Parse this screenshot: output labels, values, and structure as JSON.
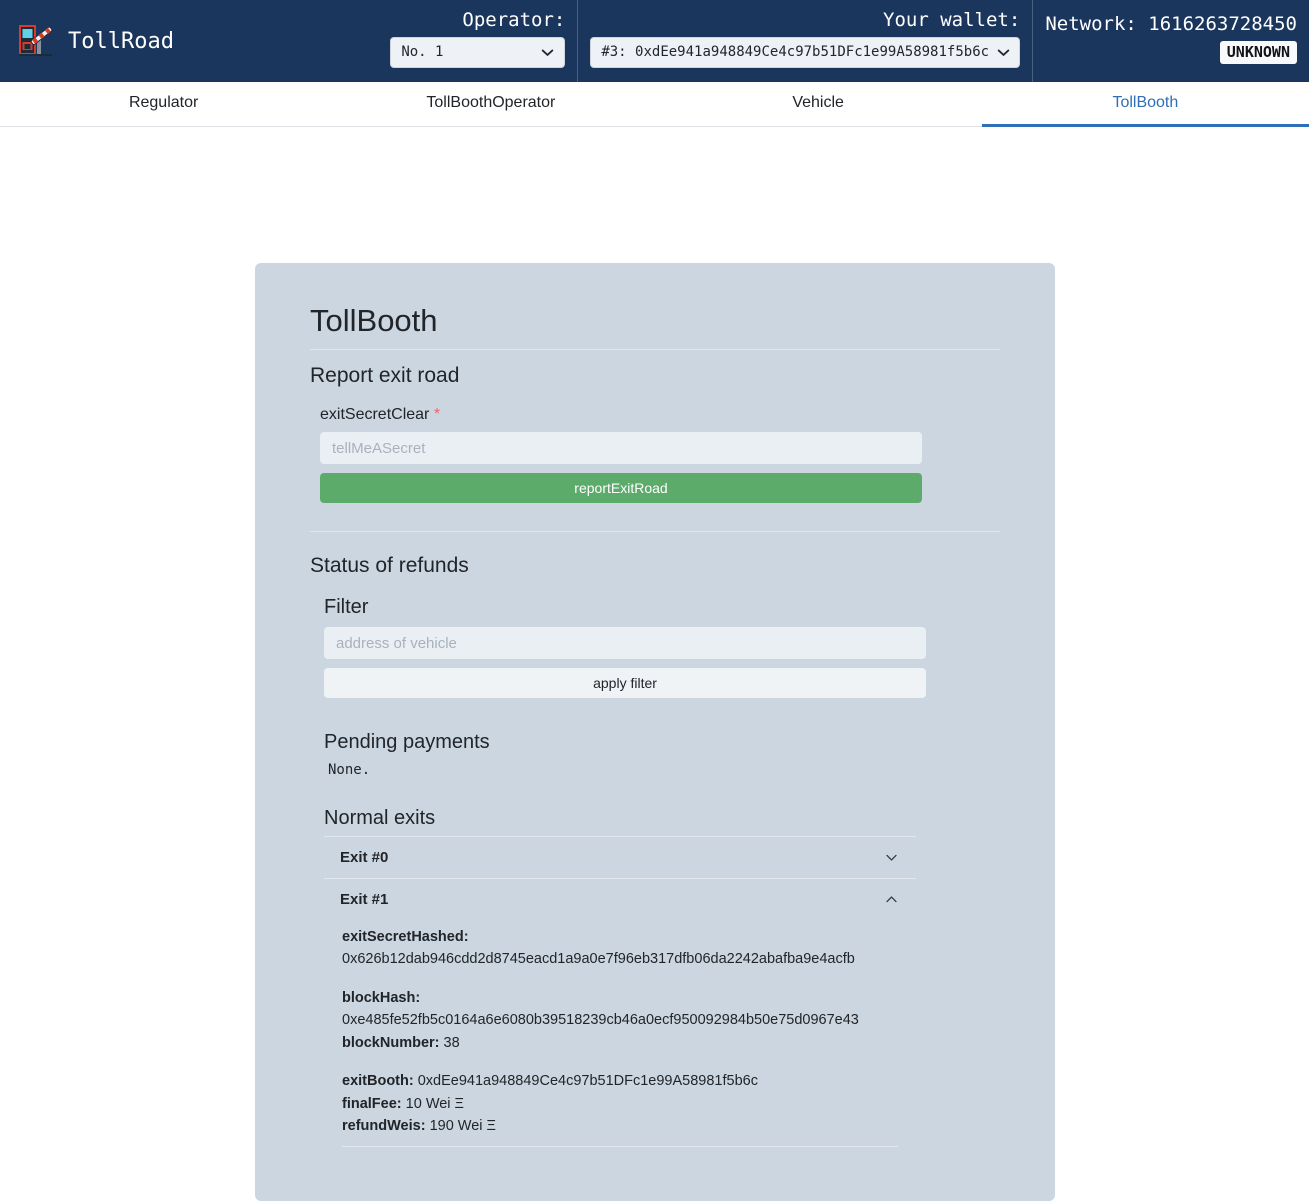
{
  "header": {
    "brand": "TollRoad",
    "logo_icon": "toll-booth-icon",
    "operator": {
      "label": "Operator:",
      "selected": "No. 1",
      "chevron_icon": "chevron-down-icon"
    },
    "wallet": {
      "label": "Your wallet:",
      "selected": "#3: 0xdEe941a948849Ce4c97b51DFc1e99A58981f5b6c",
      "chevron_icon": "chevron-down-icon"
    },
    "network": {
      "label": "Network: 1616263728450",
      "badge": "UNKNOWN"
    }
  },
  "tabs": [
    {
      "label": "Regulator",
      "active": false
    },
    {
      "label": "TollBoothOperator",
      "active": false
    },
    {
      "label": "Vehicle",
      "active": false
    },
    {
      "label": "TollBooth",
      "active": true
    }
  ],
  "card": {
    "title": "TollBooth",
    "report": {
      "section_title": "Report exit road",
      "field_label": "exitSecretClear",
      "required_marker": "*",
      "input_placeholder": "tellMeASecret",
      "input_value": "",
      "submit_label": "reportExitRoad"
    },
    "refunds": {
      "section_title": "Status of refunds",
      "filter": {
        "title": "Filter",
        "input_placeholder": "address of vehicle",
        "input_value": "",
        "apply_label": "apply filter"
      },
      "pending": {
        "title": "Pending payments",
        "empty_text": "None."
      },
      "normal_exits": {
        "title": "Normal exits",
        "items": [
          {
            "label": "Exit #0",
            "expanded": false,
            "chevron_icon": "chevron-down-icon"
          },
          {
            "label": "Exit #1",
            "expanded": true,
            "chevron_icon": "chevron-up-icon",
            "details": {
              "exit_secret_hashed_key": "exitSecretHashed:",
              "exit_secret_hashed_value": "0x626b12dab946cdd2d8745eacd1a9a0e7f96eb317dfb06da2242abafba9e4acfb",
              "block_hash_key": "blockHash:",
              "block_hash_value": "0xe485fe52fb5c0164a6e6080b39518239cb46a0ecf950092984b50e75d0967e43",
              "block_number_key": "blockNumber:",
              "block_number_value": "38",
              "exit_booth_key": "exitBooth:",
              "exit_booth_value": "0xdEe941a948849Ce4c97b51DFc1e99A58981f5b6c",
              "final_fee_key": "finalFee:",
              "final_fee_value": "10 Wei Ξ",
              "refund_weis_key": "refundWeis:",
              "refund_weis_value": "190 Wei Ξ"
            }
          }
        ]
      }
    }
  },
  "colors": {
    "navbar": "#1b365d",
    "card": "#ccd6e0",
    "accent": "#2f6fb5",
    "success": "#5cab6b",
    "required": "#e3686f"
  }
}
